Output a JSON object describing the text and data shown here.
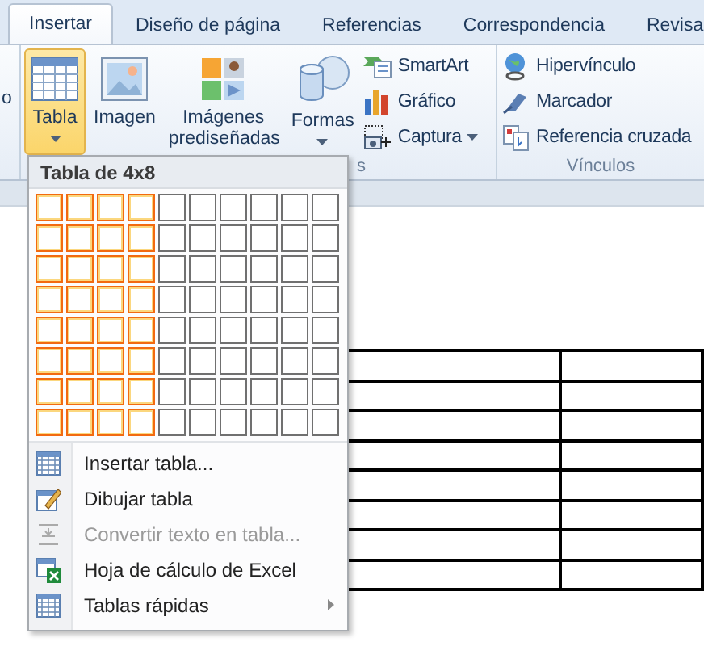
{
  "tabs": [
    {
      "label": "Insertar",
      "selected": true
    },
    {
      "label": "Diseño de página",
      "selected": false
    },
    {
      "label": "Referencias",
      "selected": false
    },
    {
      "label": "Correspondencia",
      "selected": false
    },
    {
      "label": "Revisa",
      "selected": false
    }
  ],
  "ribbon": {
    "cut_label": "o",
    "large_buttons": [
      {
        "kind": "table",
        "label": "Tabla",
        "pressed": true,
        "dropdown": true
      },
      {
        "kind": "image",
        "label": "Imagen",
        "pressed": false,
        "dropdown": false
      },
      {
        "kind": "clipart",
        "label": "Imágenes prediseñadas",
        "pressed": false,
        "dropdown": false
      },
      {
        "kind": "shapes",
        "label": "Formas",
        "pressed": false,
        "dropdown": true
      }
    ],
    "small_buttons": [
      {
        "kind": "smartart",
        "label": "SmartArt",
        "dropdown": false
      },
      {
        "kind": "chart",
        "label": "Gráfico",
        "dropdown": false
      },
      {
        "kind": "capture",
        "label": "Captura",
        "dropdown": true
      }
    ],
    "group_label": "s",
    "links_group": {
      "label": "Vínculos",
      "buttons": [
        {
          "kind": "hyperlink",
          "label": "Hipervínculo"
        },
        {
          "kind": "bookmark",
          "label": "Marcador"
        },
        {
          "kind": "crossref",
          "label": "Referencia cruzada"
        }
      ]
    }
  },
  "table_menu": {
    "title": "Tabla de 4x8",
    "grid": [
      {
        "cells": [
          {
            "selected": true
          },
          {
            "selected": true
          },
          {
            "selected": true
          },
          {
            "selected": true
          },
          {
            "selected": false
          },
          {
            "selected": false
          },
          {
            "selected": false
          },
          {
            "selected": false
          },
          {
            "selected": false
          },
          {
            "selected": false
          }
        ]
      },
      {
        "cells": [
          {
            "selected": true
          },
          {
            "selected": true
          },
          {
            "selected": true
          },
          {
            "selected": true
          },
          {
            "selected": false
          },
          {
            "selected": false
          },
          {
            "selected": false
          },
          {
            "selected": false
          },
          {
            "selected": false
          },
          {
            "selected": false
          }
        ]
      },
      {
        "cells": [
          {
            "selected": true
          },
          {
            "selected": true
          },
          {
            "selected": true
          },
          {
            "selected": true
          },
          {
            "selected": false
          },
          {
            "selected": false
          },
          {
            "selected": false
          },
          {
            "selected": false
          },
          {
            "selected": false
          },
          {
            "selected": false
          }
        ]
      },
      {
        "cells": [
          {
            "selected": true
          },
          {
            "selected": true
          },
          {
            "selected": true
          },
          {
            "selected": true
          },
          {
            "selected": false
          },
          {
            "selected": false
          },
          {
            "selected": false
          },
          {
            "selected": false
          },
          {
            "selected": false
          },
          {
            "selected": false
          }
        ]
      },
      {
        "cells": [
          {
            "selected": true
          },
          {
            "selected": true
          },
          {
            "selected": true
          },
          {
            "selected": true
          },
          {
            "selected": false
          },
          {
            "selected": false
          },
          {
            "selected": false
          },
          {
            "selected": false
          },
          {
            "selected": false
          },
          {
            "selected": false
          }
        ]
      },
      {
        "cells": [
          {
            "selected": true
          },
          {
            "selected": true
          },
          {
            "selected": true
          },
          {
            "selected": true
          },
          {
            "selected": false
          },
          {
            "selected": false
          },
          {
            "selected": false
          },
          {
            "selected": false
          },
          {
            "selected": false
          },
          {
            "selected": false
          }
        ]
      },
      {
        "cells": [
          {
            "selected": true
          },
          {
            "selected": true
          },
          {
            "selected": true
          },
          {
            "selected": true
          },
          {
            "selected": false
          },
          {
            "selected": false
          },
          {
            "selected": false
          },
          {
            "selected": false
          },
          {
            "selected": false
          },
          {
            "selected": false
          }
        ]
      },
      {
        "cells": [
          {
            "selected": true
          },
          {
            "selected": true
          },
          {
            "selected": true
          },
          {
            "selected": true
          },
          {
            "selected": false
          },
          {
            "selected": false
          },
          {
            "selected": false
          },
          {
            "selected": false
          },
          {
            "selected": false
          },
          {
            "selected": false
          }
        ]
      }
    ],
    "items": [
      {
        "kind": "insert",
        "label": "Insertar tabla...",
        "disabled": false,
        "submenu": false
      },
      {
        "kind": "draw",
        "label": "Dibujar tabla",
        "disabled": false,
        "submenu": false
      },
      {
        "kind": "convert",
        "label": "Convertir texto en tabla...",
        "disabled": true,
        "submenu": false
      },
      {
        "kind": "excel",
        "label": "Hoja de cálculo de Excel",
        "disabled": false,
        "submenu": false
      },
      {
        "kind": "quick",
        "label": "Tablas rápidas",
        "disabled": false,
        "submenu": true
      }
    ]
  }
}
